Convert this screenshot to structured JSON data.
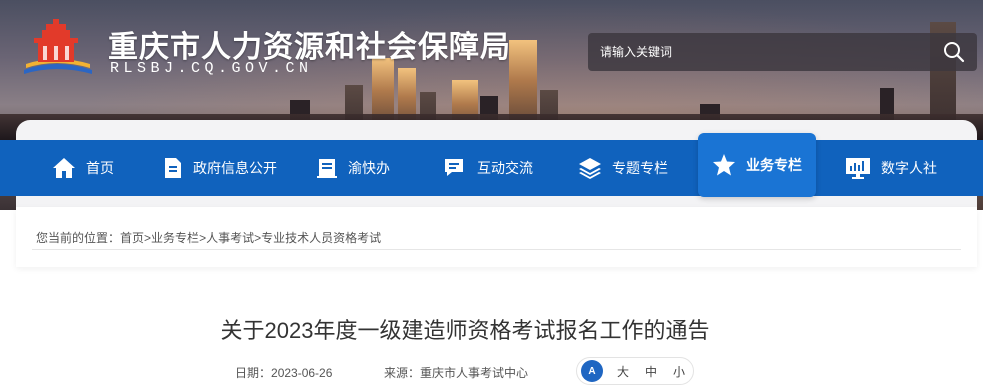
{
  "header": {
    "title": "重庆市人力资源和社会保障局",
    "domain": "RLSBJ.CQ.GOV.CN"
  },
  "search": {
    "placeholder": "请输入关键词",
    "icon": "search-icon"
  },
  "nav": {
    "items": [
      {
        "label": "首页",
        "icon": "home-icon"
      },
      {
        "label": "政府信息公开",
        "icon": "document-icon"
      },
      {
        "label": "渝快办",
        "icon": "clipboard-icon"
      },
      {
        "label": "互动交流",
        "icon": "chat-icon"
      },
      {
        "label": "专题专栏",
        "icon": "layers-icon"
      },
      {
        "label": "业务专栏",
        "icon": "star-icon",
        "active": true
      },
      {
        "label": "数字人社",
        "icon": "monitor-icon"
      }
    ]
  },
  "breadcrumb": {
    "prefix": "您当前的位置：",
    "items": [
      "首页",
      "业务专栏",
      "人事考试",
      "专业技术人员资格考试"
    ],
    "separator": ">"
  },
  "article": {
    "title": "关于2023年度一级建造师资格考试报名工作的通告",
    "date_label": "日期：",
    "date": "2023-06-26",
    "source_label": "来源：",
    "source": "重庆市人事考试中心",
    "font_size": {
      "icon_text": "A",
      "large": "大",
      "medium": "中",
      "small": "小"
    }
  },
  "colors": {
    "nav_bg": "#1062bd",
    "nav_active": "#1a74d4",
    "accent": "#1f66c2"
  }
}
